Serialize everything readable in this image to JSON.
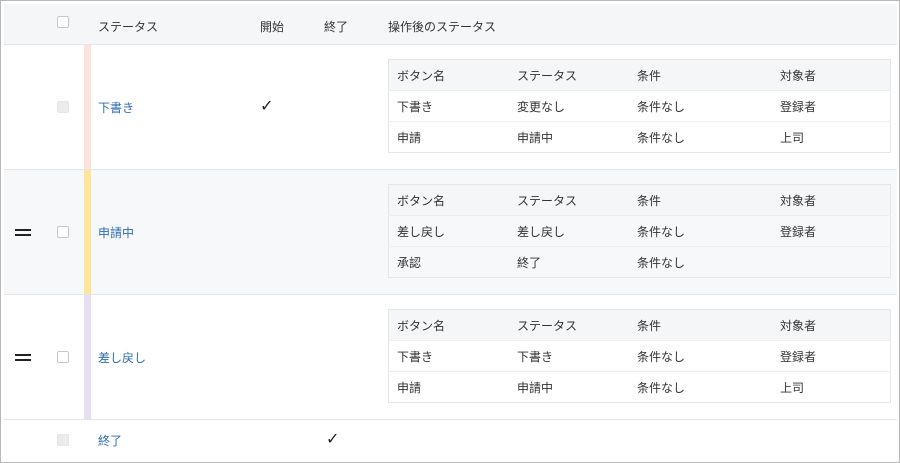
{
  "header": {
    "status": "ステータス",
    "start": "開始",
    "end": "終了",
    "after_status": "操作後のステータス"
  },
  "colors": {
    "draft": "#fbe3d9",
    "applying": "#fde59a",
    "returned": "#e6dff0",
    "link": "#2f6db5"
  },
  "rows": [
    {
      "status": "下書き",
      "start_check": "✓",
      "table": {
        "headers": [
          "ボタン名",
          "ステータス",
          "条件",
          "対象者"
        ],
        "rows": [
          [
            "下書き",
            "変更なし",
            "条件なし",
            "登録者"
          ],
          [
            "申請",
            "申請中",
            "条件なし",
            "上司"
          ]
        ]
      }
    },
    {
      "status": "申請中",
      "table": {
        "headers": [
          "ボタン名",
          "ステータス",
          "条件",
          "対象者"
        ],
        "rows": [
          [
            "差し戻し",
            "差し戻し",
            "条件なし",
            "登録者"
          ],
          [
            "承認",
            "終了",
            "条件なし",
            ""
          ]
        ]
      }
    },
    {
      "status": "差し戻し",
      "table": {
        "headers": [
          "ボタン名",
          "ステータス",
          "条件",
          "対象者"
        ],
        "rows": [
          [
            "下書き",
            "下書き",
            "条件なし",
            "登録者"
          ],
          [
            "申請",
            "申請中",
            "条件なし",
            "上司"
          ]
        ]
      }
    },
    {
      "status": "終了",
      "end_check": "✓"
    }
  ]
}
